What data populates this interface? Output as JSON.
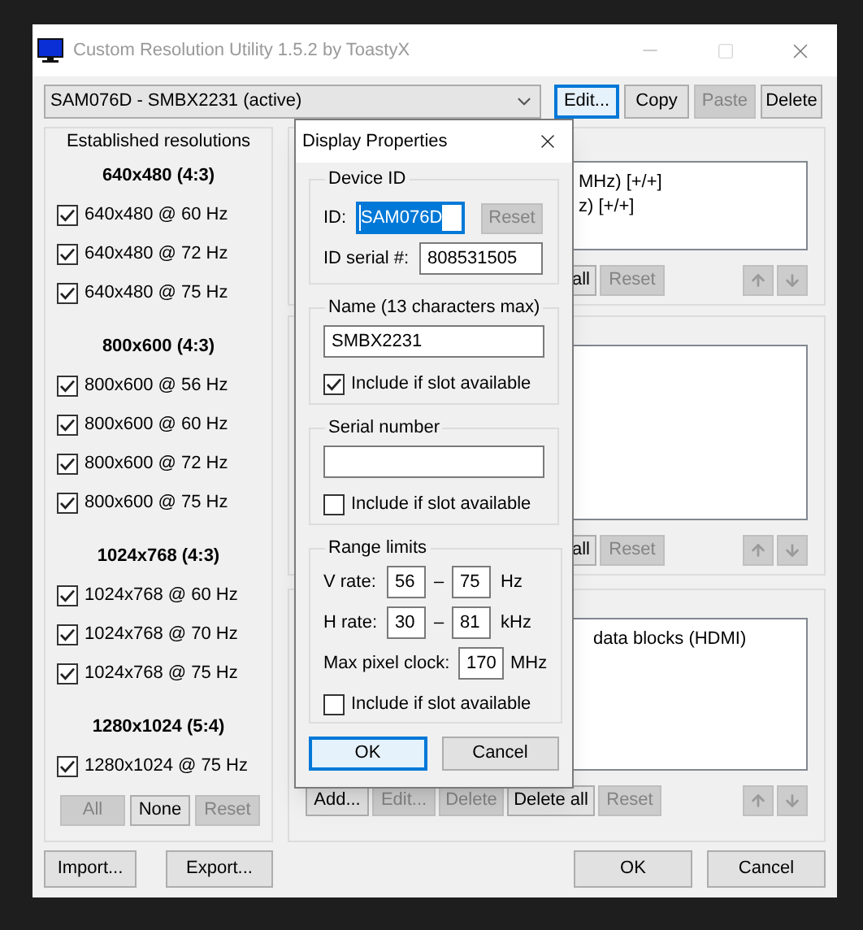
{
  "window": {
    "title": "Custom Resolution Utility 1.5.2 by ToastyX"
  },
  "display_select": {
    "value": "SAM076D - SMBX2231 (active)"
  },
  "top_buttons": [
    {
      "label": "Edit...",
      "disabled": false,
      "focused": true
    },
    {
      "label": "Copy",
      "disabled": false,
      "focused": false
    },
    {
      "label": "Paste",
      "disabled": true,
      "focused": false
    },
    {
      "label": "Delete",
      "disabled": false,
      "focused": false
    }
  ],
  "established": {
    "title": "Established resolutions",
    "groups": [
      {
        "heading": "640x480 (4:3)",
        "items": [
          {
            "label": "640x480 @ 60 Hz",
            "checked": true
          },
          {
            "label": "640x480 @ 72 Hz",
            "checked": true
          },
          {
            "label": "640x480 @ 75 Hz",
            "checked": true
          }
        ]
      },
      {
        "heading": "800x600 (4:3)",
        "items": [
          {
            "label": "800x600 @ 56 Hz",
            "checked": true
          },
          {
            "label": "800x600 @ 60 Hz",
            "checked": true
          },
          {
            "label": "800x600 @ 72 Hz",
            "checked": true
          },
          {
            "label": "800x600 @ 75 Hz",
            "checked": true
          }
        ]
      },
      {
        "heading": "1024x768 (4:3)",
        "items": [
          {
            "label": "1024x768 @ 60 Hz",
            "checked": true
          },
          {
            "label": "1024x768 @ 70 Hz",
            "checked": true
          },
          {
            "label": "1024x768 @ 75 Hz",
            "checked": true
          }
        ]
      },
      {
        "heading": "1280x1024 (5:4)",
        "items": [
          {
            "label": "1280x1024 @ 75 Hz",
            "checked": true
          }
        ]
      }
    ],
    "buttons": [
      {
        "label": "All",
        "disabled": true
      },
      {
        "label": "None",
        "disabled": false
      },
      {
        "label": "Reset",
        "disabled": true
      }
    ]
  },
  "right_panels": [
    {
      "lines": [
        "MHz) [+/+]",
        "z) [+/+]"
      ],
      "buttons": [
        {
          "label": "all",
          "disabled": false
        },
        {
          "label": "Reset",
          "disabled": true
        }
      ]
    },
    {
      "buttons": [
        {
          "label": "all",
          "disabled": false
        },
        {
          "label": "Reset",
          "disabled": true
        }
      ]
    },
    {
      "lines": [
        "data blocks (HDMI)"
      ],
      "buttons": [
        {
          "label": "Add...",
          "disabled": false
        },
        {
          "label": "Edit...",
          "disabled": true
        },
        {
          "label": "Delete",
          "disabled": true
        },
        {
          "label": "Delete all",
          "disabled": false
        },
        {
          "label": "Reset",
          "disabled": true
        }
      ]
    }
  ],
  "bottom_buttons": {
    "left": [
      "Import...",
      "Export..."
    ],
    "right": [
      "OK",
      "Cancel"
    ]
  },
  "dialog": {
    "title": "Display Properties",
    "device_id": {
      "title": "Device ID",
      "id_label": "ID:",
      "id_value": "SAM076D",
      "id_selected": true,
      "reset": {
        "label": "Reset",
        "disabled": true
      },
      "serial_label": "ID serial #:",
      "serial_value": "808531505"
    },
    "name": {
      "title": "Name (13 characters max)",
      "value": "SMBX2231",
      "include": {
        "label": "Include if slot available",
        "checked": true
      }
    },
    "serial_number": {
      "title": "Serial number",
      "include": {
        "label": "Include if slot available",
        "checked": false
      }
    },
    "range_limits": {
      "title": "Range limits",
      "rows": [
        {
          "label": "V rate:",
          "min": "56",
          "separator": "–",
          "max": "75",
          "unit": "Hz"
        },
        {
          "label": "H rate:",
          "min": "30",
          "separator": "–",
          "max": "81",
          "unit": "kHz"
        }
      ],
      "pixel_clock": {
        "label": "Max pixel clock:",
        "value": "170",
        "unit": "MHz"
      },
      "include": {
        "label": "Include if slot available",
        "checked": false
      }
    },
    "buttons": [
      {
        "label": "OK",
        "focused": true
      },
      {
        "label": "Cancel",
        "focused": false
      }
    ]
  }
}
